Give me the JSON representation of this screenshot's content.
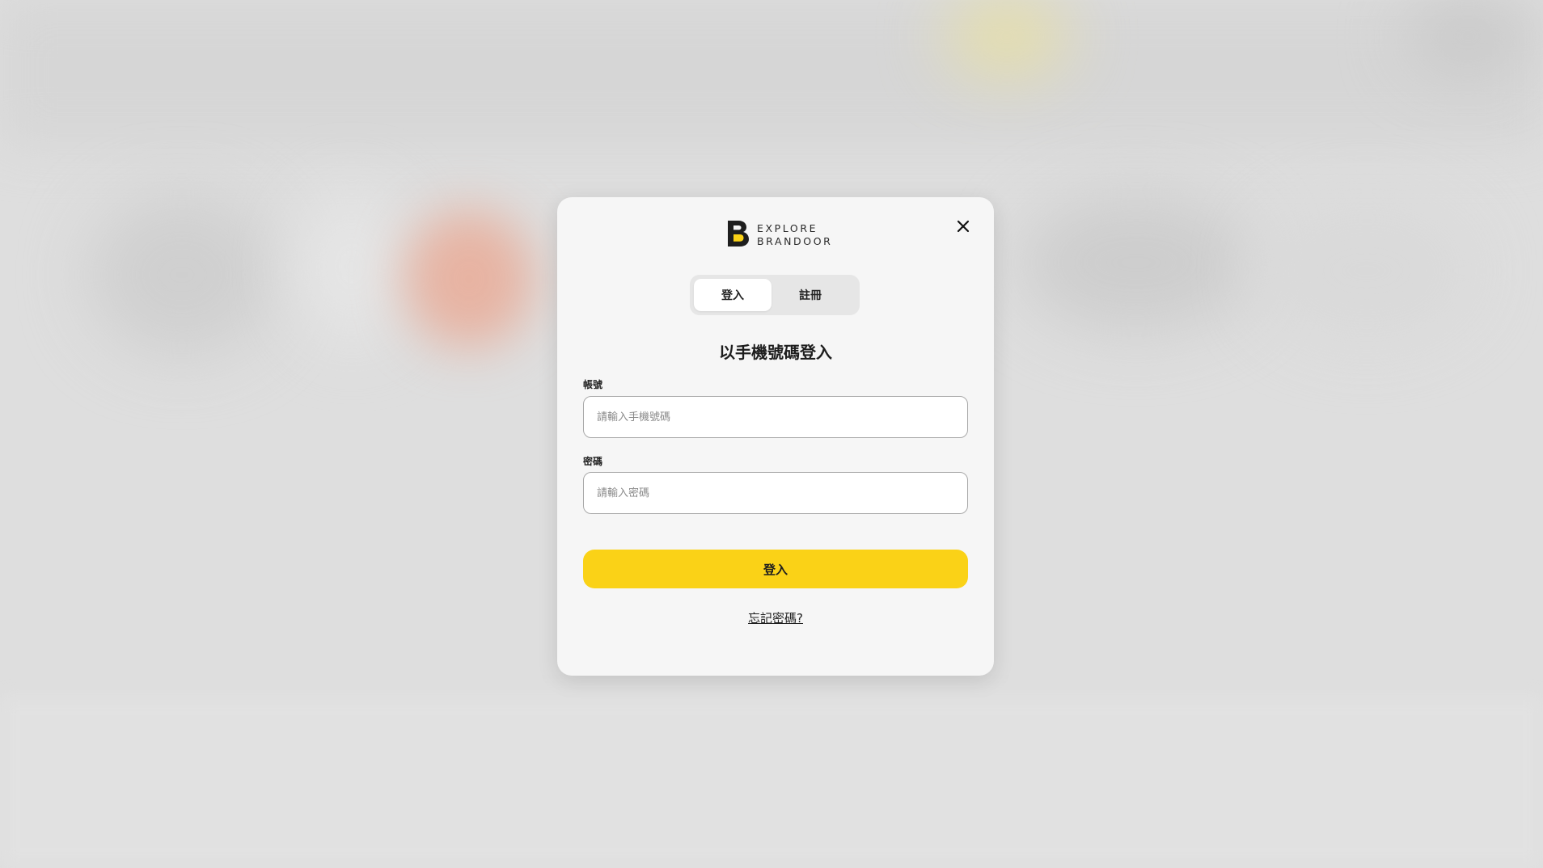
{
  "modal": {
    "logo": {
      "line1": "EXPLORE",
      "line2": "BRANDOOR",
      "icon": "brandoor-b-logo-icon",
      "accent": "#fad217"
    },
    "close_icon": "close-icon",
    "tabs": [
      {
        "label": "登入",
        "active": true
      },
      {
        "label": "註冊",
        "active": false
      }
    ],
    "heading": "以手機號碼登入",
    "account": {
      "label": "帳號",
      "placeholder": "請輸入手機號碼"
    },
    "password": {
      "label": "密碼",
      "placeholder": "請輸入密碼"
    },
    "submit_label": "登入",
    "forgot_label": "忘記密碼?"
  },
  "colors": {
    "primary": "#fad217",
    "modal_bg": "#f6f6f6",
    "overlay_bg": "#dedede"
  }
}
